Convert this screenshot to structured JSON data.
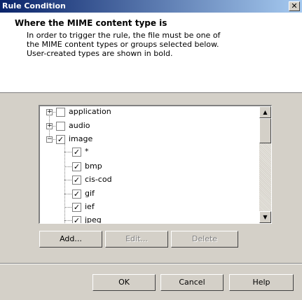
{
  "window": {
    "title": "Rule Condition",
    "close_glyph": "✕"
  },
  "header": {
    "title": "Where the MIME content type is",
    "description_lines": [
      "In order to trigger the rule, the file must be one of",
      "the MIME content types or groups selected below.",
      "User-created types are shown in bold."
    ]
  },
  "tree": {
    "items": [
      {
        "label": "application",
        "checked": false,
        "expandable": true,
        "expanded": false
      },
      {
        "label": "audio",
        "checked": false,
        "expandable": true,
        "expanded": false
      },
      {
        "label": "image",
        "checked": true,
        "expandable": true,
        "expanded": true
      },
      {
        "label": "*",
        "checked": true
      },
      {
        "label": "bmp",
        "checked": true
      },
      {
        "label": "cis-cod",
        "checked": true
      },
      {
        "label": "gif",
        "checked": true
      },
      {
        "label": "ief",
        "checked": true
      },
      {
        "label": "jpeg",
        "checked": true
      }
    ]
  },
  "list_buttons": {
    "add": "Add...",
    "edit": "Edit...",
    "delete": "Delete"
  },
  "dialog_buttons": {
    "ok": "OK",
    "cancel": "Cancel",
    "help": "Help"
  }
}
